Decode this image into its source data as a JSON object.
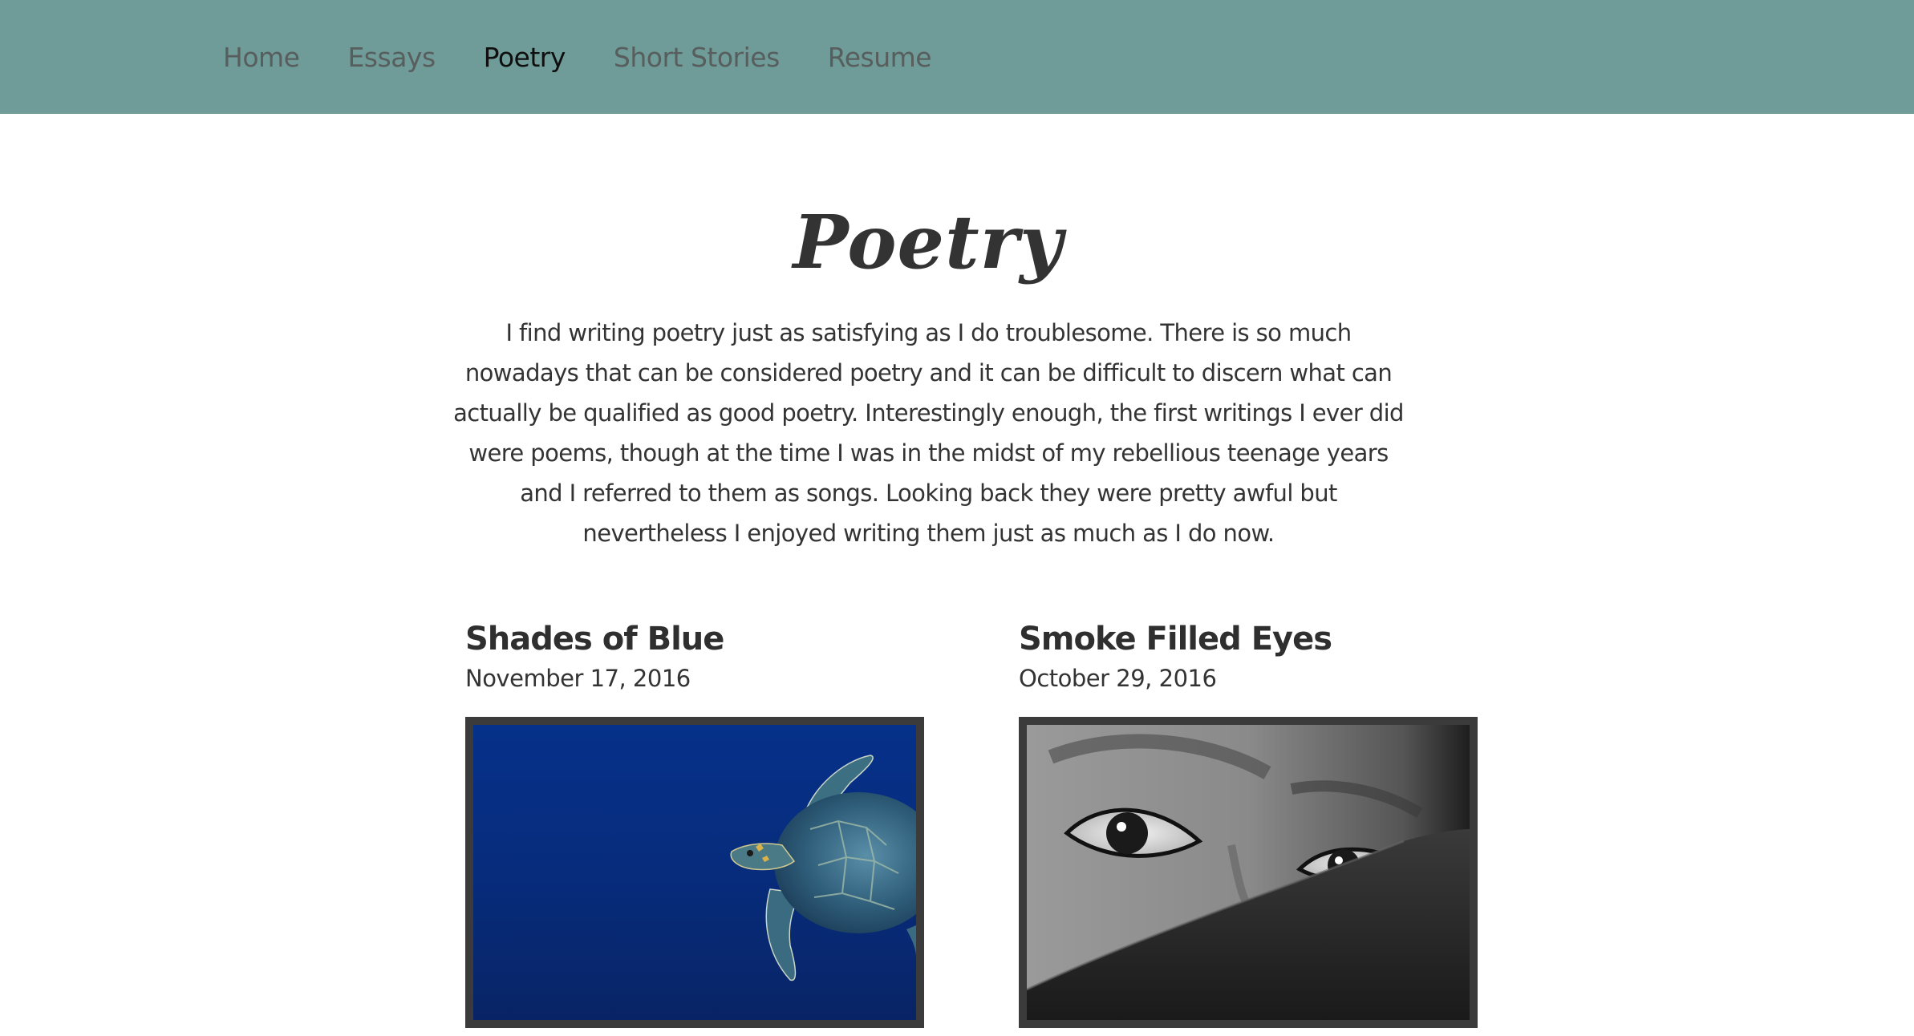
{
  "nav": {
    "items": [
      {
        "label": "Home",
        "active": false
      },
      {
        "label": "Essays",
        "active": false
      },
      {
        "label": "Poetry",
        "active": true
      },
      {
        "label": "Short Stories",
        "active": false
      },
      {
        "label": "Resume",
        "active": false
      }
    ]
  },
  "page": {
    "title": "Poetry",
    "intro": "I find writing poetry just as satisfying as I do troublesome. There is so much nowadays that can be considered poetry and it can be difficult to discern what can actually be qualified as good poetry. Interestingly enough, the first writings I ever did were poems, though at the time I was in the midst of my rebellious teenage years and I referred to them as songs. Looking back they were pretty awful but nevertheless I enjoyed writing them just as much as I do now."
  },
  "posts": [
    {
      "title": "Shades of Blue",
      "date": "November 17, 2016",
      "image_icon": "sea-turtle-photo"
    },
    {
      "title": "Smoke Filled Eyes",
      "date": "October 29, 2016",
      "image_icon": "eyes-photo"
    }
  ],
  "colors": {
    "header_bg": "#6f9c98",
    "nav_text": "#575e5d",
    "nav_active": "#0f0f0f",
    "body_text": "#333333",
    "frame": "#3b3b3b"
  }
}
